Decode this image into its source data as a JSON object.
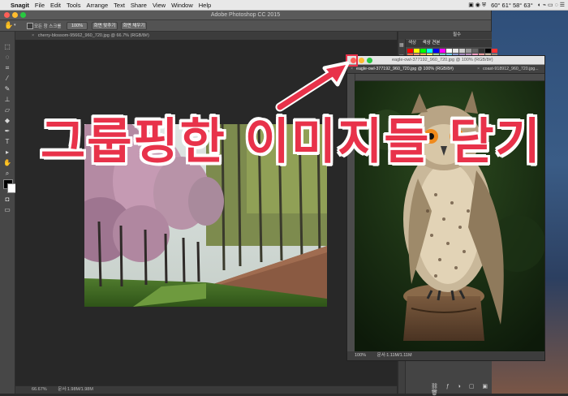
{
  "menubar": {
    "apple": "",
    "app": "Snagit",
    "items": [
      "File",
      "Edit",
      "Tools",
      "Arrange",
      "Text",
      "Share",
      "View",
      "Window",
      "Help"
    ],
    "status_text": "60°  61°  58°  63°"
  },
  "photoshop": {
    "window_title": "Adobe Photoshop CC 2015",
    "options": {
      "checkbox_label": "모든 창 스크롤",
      "zoom_value": "100%",
      "fit_screen_label": "화면 맞추기",
      "fill_screen_label": "화면 채우기"
    },
    "doc_tab": "cherry-blossom-95662_960_720.jpg @ 66.7% (RGB/8#)",
    "status": {
      "zoom": "66.67%",
      "doc_size": "문서:1.98M/1.98M"
    },
    "right_panel": {
      "tabs": [
        "색상",
        "색상 견본"
      ],
      "workspace": "필수"
    }
  },
  "float_window": {
    "title": "eagle-owl-377192_960_720.jpg @ 100% (RGB/8#)",
    "tabs": [
      "eagle-owl-377192_960_720.jpg @ 100% (RGB/8#)",
      "coast-918912_960_720.jpg..."
    ],
    "status": {
      "zoom": "100%",
      "doc_size": "문서:1.11M/1.11M"
    }
  },
  "overlay": {
    "title": "그룹핑한 이미지들 닫기",
    "accent_color": "#e8324a"
  }
}
